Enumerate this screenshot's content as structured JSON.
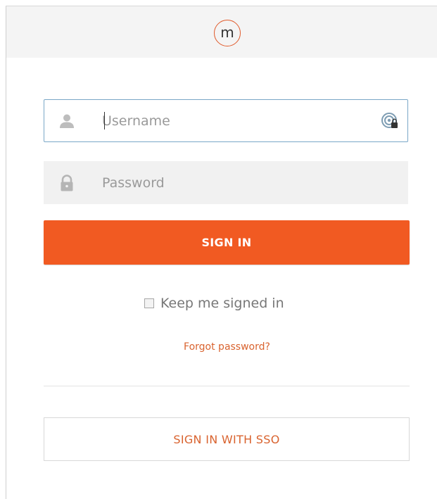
{
  "header": {
    "logo_letter": "m"
  },
  "login": {
    "username_placeholder": "Username",
    "password_placeholder": "Password",
    "signin_label": "SIGN IN",
    "keep_signed_in_label": "Keep me signed in",
    "keep_signed_in_checked": false,
    "forgot_password_label": "Forgot password?",
    "sso_label": "SIGN IN WITH SSO"
  },
  "icons": {
    "username": "user-icon",
    "password": "lock-icon",
    "password_manager": "password-manager-icon"
  },
  "colors": {
    "accent": "#f15a22",
    "link": "#d9632f",
    "focus_border": "#7aa7c7"
  }
}
